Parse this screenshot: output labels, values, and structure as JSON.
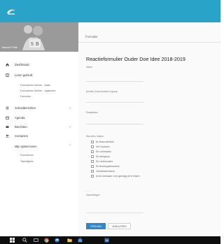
{
  "app": {
    "accent_color": "#2aa3c8",
    "logo_icon": "swirl-logo-icon"
  },
  "sidebar": {
    "profile_name": "Marcel Polle",
    "items": [
      {
        "label": "Dashboard",
        "icon": "home-icon"
      },
      {
        "label": "Leren gebruik",
        "icon": "book-icon"
      },
      {
        "label": "Schoolberichten",
        "icon": "list-icon"
      },
      {
        "label": "Agenda",
        "icon": "calendar-icon"
      },
      {
        "label": "Berichten",
        "icon": "mail-icon"
      },
      {
        "label": "Contacten",
        "icon": "people-icon"
      },
      {
        "label": "Mijn opties tonen",
        "icon": ""
      }
    ],
    "subitems_a": [
      "Formulieren beheer - basis",
      "Formulieren beheer - uitgebreid",
      "Formulier"
    ],
    "subitems_b": [
      "Formulieren",
      "Takenlijsten"
    ]
  },
  "content": {
    "breadcrumb": "Formulier",
    "title": "Reactieformulier Ouder Doe Idee 2018-2019",
    "fields": {
      "name_label": "Naam",
      "child_label": "(Kinder) Zoon/dochter in groep",
      "email_label": "Emailadres",
      "help_label": "Wat wilt u helpen",
      "remarks_label": "Opmerkingen"
    },
    "checkboxes": [
      "De Boscommissie",
      "Het Voorlezen",
      "De Lichtvrijheid",
      "De werkgroep",
      "De Luizenouders",
      "De leesmoppelinouders",
      "Juniorklassenwens",
      "Ik ben bekwaam in de genoegd de te helpen"
    ],
    "buttons": {
      "save": "OPSLAAN",
      "cancel": "ANNULEREN"
    }
  },
  "taskbar": {
    "icons": [
      "windows-icon",
      "search-icon",
      "task-view-icon",
      "chrome-icon",
      "edge-icon",
      "folder-icon",
      "store-icon",
      "word-icon"
    ]
  }
}
